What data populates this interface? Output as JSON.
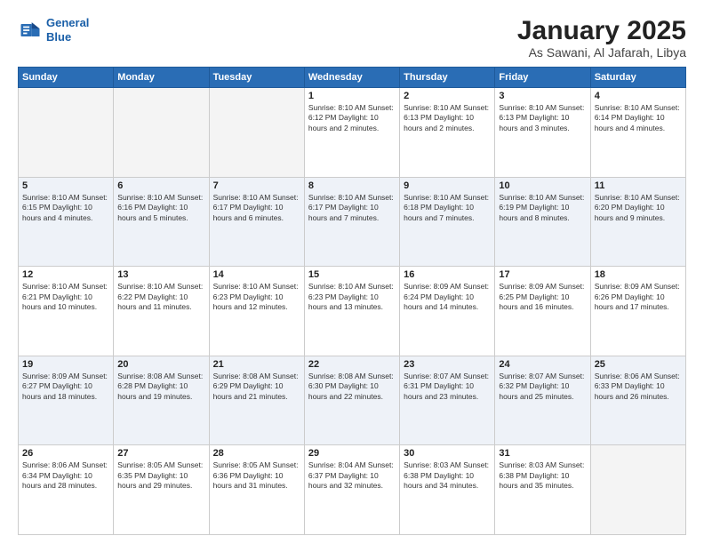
{
  "logo": {
    "line1": "General",
    "line2": "Blue"
  },
  "title": "January 2025",
  "subtitle": "As Sawani, Al Jafarah, Libya",
  "days_of_week": [
    "Sunday",
    "Monday",
    "Tuesday",
    "Wednesday",
    "Thursday",
    "Friday",
    "Saturday"
  ],
  "weeks": [
    [
      {
        "day": "",
        "info": ""
      },
      {
        "day": "",
        "info": ""
      },
      {
        "day": "",
        "info": ""
      },
      {
        "day": "1",
        "info": "Sunrise: 8:10 AM\nSunset: 6:12 PM\nDaylight: 10 hours\nand 2 minutes."
      },
      {
        "day": "2",
        "info": "Sunrise: 8:10 AM\nSunset: 6:13 PM\nDaylight: 10 hours\nand 2 minutes."
      },
      {
        "day": "3",
        "info": "Sunrise: 8:10 AM\nSunset: 6:13 PM\nDaylight: 10 hours\nand 3 minutes."
      },
      {
        "day": "4",
        "info": "Sunrise: 8:10 AM\nSunset: 6:14 PM\nDaylight: 10 hours\nand 4 minutes."
      }
    ],
    [
      {
        "day": "5",
        "info": "Sunrise: 8:10 AM\nSunset: 6:15 PM\nDaylight: 10 hours\nand 4 minutes."
      },
      {
        "day": "6",
        "info": "Sunrise: 8:10 AM\nSunset: 6:16 PM\nDaylight: 10 hours\nand 5 minutes."
      },
      {
        "day": "7",
        "info": "Sunrise: 8:10 AM\nSunset: 6:17 PM\nDaylight: 10 hours\nand 6 minutes."
      },
      {
        "day": "8",
        "info": "Sunrise: 8:10 AM\nSunset: 6:17 PM\nDaylight: 10 hours\nand 7 minutes."
      },
      {
        "day": "9",
        "info": "Sunrise: 8:10 AM\nSunset: 6:18 PM\nDaylight: 10 hours\nand 7 minutes."
      },
      {
        "day": "10",
        "info": "Sunrise: 8:10 AM\nSunset: 6:19 PM\nDaylight: 10 hours\nand 8 minutes."
      },
      {
        "day": "11",
        "info": "Sunrise: 8:10 AM\nSunset: 6:20 PM\nDaylight: 10 hours\nand 9 minutes."
      }
    ],
    [
      {
        "day": "12",
        "info": "Sunrise: 8:10 AM\nSunset: 6:21 PM\nDaylight: 10 hours\nand 10 minutes."
      },
      {
        "day": "13",
        "info": "Sunrise: 8:10 AM\nSunset: 6:22 PM\nDaylight: 10 hours\nand 11 minutes."
      },
      {
        "day": "14",
        "info": "Sunrise: 8:10 AM\nSunset: 6:23 PM\nDaylight: 10 hours\nand 12 minutes."
      },
      {
        "day": "15",
        "info": "Sunrise: 8:10 AM\nSunset: 6:23 PM\nDaylight: 10 hours\nand 13 minutes."
      },
      {
        "day": "16",
        "info": "Sunrise: 8:09 AM\nSunset: 6:24 PM\nDaylight: 10 hours\nand 14 minutes."
      },
      {
        "day": "17",
        "info": "Sunrise: 8:09 AM\nSunset: 6:25 PM\nDaylight: 10 hours\nand 16 minutes."
      },
      {
        "day": "18",
        "info": "Sunrise: 8:09 AM\nSunset: 6:26 PM\nDaylight: 10 hours\nand 17 minutes."
      }
    ],
    [
      {
        "day": "19",
        "info": "Sunrise: 8:09 AM\nSunset: 6:27 PM\nDaylight: 10 hours\nand 18 minutes."
      },
      {
        "day": "20",
        "info": "Sunrise: 8:08 AM\nSunset: 6:28 PM\nDaylight: 10 hours\nand 19 minutes."
      },
      {
        "day": "21",
        "info": "Sunrise: 8:08 AM\nSunset: 6:29 PM\nDaylight: 10 hours\nand 21 minutes."
      },
      {
        "day": "22",
        "info": "Sunrise: 8:08 AM\nSunset: 6:30 PM\nDaylight: 10 hours\nand 22 minutes."
      },
      {
        "day": "23",
        "info": "Sunrise: 8:07 AM\nSunset: 6:31 PM\nDaylight: 10 hours\nand 23 minutes."
      },
      {
        "day": "24",
        "info": "Sunrise: 8:07 AM\nSunset: 6:32 PM\nDaylight: 10 hours\nand 25 minutes."
      },
      {
        "day": "25",
        "info": "Sunrise: 8:06 AM\nSunset: 6:33 PM\nDaylight: 10 hours\nand 26 minutes."
      }
    ],
    [
      {
        "day": "26",
        "info": "Sunrise: 8:06 AM\nSunset: 6:34 PM\nDaylight: 10 hours\nand 28 minutes."
      },
      {
        "day": "27",
        "info": "Sunrise: 8:05 AM\nSunset: 6:35 PM\nDaylight: 10 hours\nand 29 minutes."
      },
      {
        "day": "28",
        "info": "Sunrise: 8:05 AM\nSunset: 6:36 PM\nDaylight: 10 hours\nand 31 minutes."
      },
      {
        "day": "29",
        "info": "Sunrise: 8:04 AM\nSunset: 6:37 PM\nDaylight: 10 hours\nand 32 minutes."
      },
      {
        "day": "30",
        "info": "Sunrise: 8:03 AM\nSunset: 6:38 PM\nDaylight: 10 hours\nand 34 minutes."
      },
      {
        "day": "31",
        "info": "Sunrise: 8:03 AM\nSunset: 6:38 PM\nDaylight: 10 hours\nand 35 minutes."
      },
      {
        "day": "",
        "info": ""
      }
    ]
  ]
}
